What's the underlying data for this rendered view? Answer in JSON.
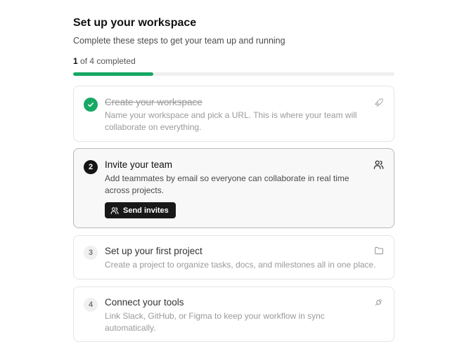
{
  "header": {
    "title": "Set up your workspace",
    "subtitle": "Complete these steps to get your team up and running"
  },
  "progress": {
    "completed": "1",
    "rest": " of 4 completed",
    "fraction": 0.25,
    "accent_color": "#16a864"
  },
  "steps": [
    {
      "number": "✓",
      "status": "done",
      "title": "Create your workspace",
      "description": "Name your workspace and pick a URL. This is where your team will collaborate on everything.",
      "icon": "rocket-icon"
    },
    {
      "number": "2",
      "status": "current",
      "title": "Invite your team",
      "description": "Add teammates by email so everyone can collaborate in real time across projects.",
      "icon": "users-icon",
      "action_label": "Send invites"
    },
    {
      "number": "3",
      "status": "pending",
      "title": "Set up your first project",
      "description": "Create a project to organize tasks, docs, and milestones all in one place.",
      "icon": "folder-icon"
    },
    {
      "number": "4",
      "status": "pending",
      "title": "Connect your tools",
      "description": "Link Slack, GitHub, or Figma to keep your workflow in sync automatically.",
      "icon": "plug-icon"
    }
  ]
}
